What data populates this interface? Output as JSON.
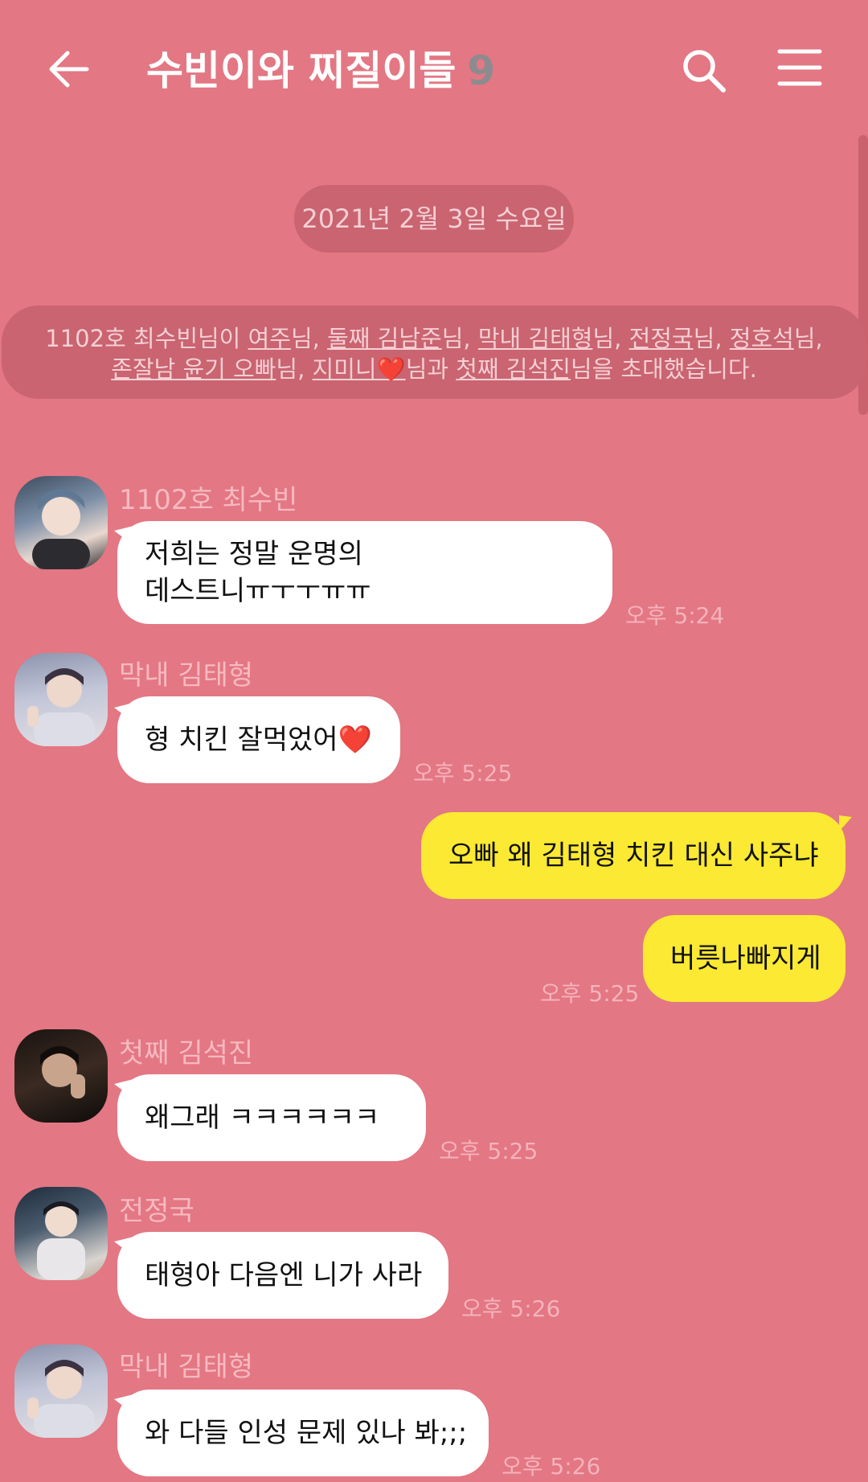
{
  "header": {
    "title": "수빈이와 찌질이들",
    "member_count": "9",
    "back_icon": "arrow-left-icon",
    "search_icon": "search-icon",
    "menu_icon": "hamburger-menu-icon"
  },
  "date_divider": "2021년 2월 3일 수요일",
  "system_message": {
    "line1": {
      "prefix": "1102호 최수빈님이 ",
      "n1": "여주",
      "s1": "님, ",
      "n2": "둘째 김남준",
      "s2": "님, ",
      "n3": "막내 김태형",
      "s3": "님, ",
      "n4": "전정국",
      "s4": "님, ",
      "n5": "정호석",
      "s5": "님,"
    },
    "line2": {
      "n6": "존잘남 윤기 오빠",
      "s6": "님, ",
      "n7": "지미니❤️",
      "s7": "님과 ",
      "n8": "첫째 김석진",
      "s8": "님을 초대했습니다."
    }
  },
  "messages": [
    {
      "sender": "1102호 최수빈",
      "line1": "저희는 정말 운명의",
      "line2": "데스트니ㅠㅜㅜㅠㅠ",
      "time": "오후 5:24",
      "avatar": "avatar-choi-soobin"
    },
    {
      "sender": "막내 김태형",
      "text": "형 치킨 잘먹었어❤️",
      "time": "오후 5:25",
      "avatar": "avatar-kim-taehyung"
    },
    {
      "text": "오빠 왜 김태형 치킨 대신 사주냐",
      "mine": true
    },
    {
      "text": "버릇나빠지게",
      "time": "오후 5:25",
      "mine": true
    },
    {
      "sender": "첫째 김석진",
      "text": "왜그래 ㅋㅋㅋㅋㅋㅋ",
      "time": "오후 5:25",
      "avatar": "avatar-kim-seokjin"
    },
    {
      "sender": "전정국",
      "text": "태형아 다음엔 니가 사라",
      "time": "오후 5:26",
      "avatar": "avatar-jeon-jungkook"
    },
    {
      "sender": "막내 김태형",
      "text": "와 다들 인성 문제 있나 봐;;;",
      "time": "오후 5:26",
      "avatar": "avatar-kim-taehyung"
    }
  ],
  "colors": {
    "background": "#e37783",
    "bubble_incoming": "#ffffff",
    "bubble_outgoing": "#fbe933",
    "pill": "#c96470"
  }
}
